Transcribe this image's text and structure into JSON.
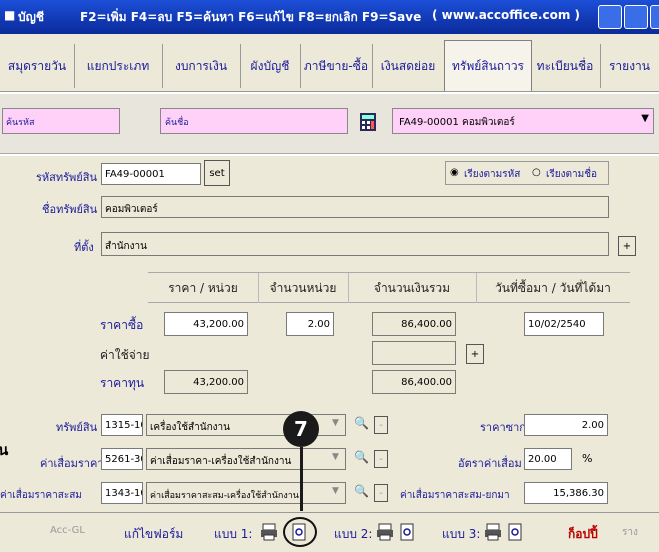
{
  "titlebar": {
    "app_label": "บัญชี",
    "shortcuts": "F2=เพิ่ม F4=ลบ F5=ค้นหา F6=แก้ไข F8=ยกเลิก F9=Save",
    "website": "( www.accoffice.com )"
  },
  "tabs": [
    {
      "label": "สมุดรายวัน"
    },
    {
      "label": "แยกประเภท"
    },
    {
      "label": "งบการเงิน"
    },
    {
      "label": "ผังบัญชี"
    },
    {
      "label": "ภาษีขาย-ซื้อ"
    },
    {
      "label": "เงินสดย่อย"
    },
    {
      "label": "ทรัพย์สินถาวร"
    },
    {
      "label": "ทะเบียนชื่อ"
    },
    {
      "label": "รายงาน"
    }
  ],
  "search": {
    "code_label": "ค้นรหัส",
    "name_label": "ค้นชื่อ",
    "selected_value": "FA49-00001   คอมพิวเตอร์"
  },
  "asset": {
    "code_label": "รหัสทรัพย์สิน",
    "code_value": "FA49-00001",
    "set_button": "set",
    "sort_by_code": "เรียงตามรหัส",
    "sort_by_name": "เรียงตามชื่อ",
    "name_label": "ชื่อทรัพย์สิน",
    "name_value": "คอมพิวเตอร์",
    "location_label": "ที่ตั้ง",
    "location_value": "สำนักงาน",
    "add_location_button": "+"
  },
  "price_table": {
    "headers": [
      "ราคา / หน่วย",
      "จำนวนหน่วย",
      "จำนวนเงินรวม",
      "วันที่ซื้อมา / วันที่ได้มา"
    ],
    "purchase_label": "ราคาซื้อ",
    "expense_label": "ค่าใช้จ่าย",
    "cost_label": "ราคาทุน",
    "unit_price": "43,200.00",
    "units": "2.00",
    "total": "86,400.00",
    "date": "10/02/2540",
    "expense_add_button": "+",
    "cost_unit": "43,200.00",
    "cost_total": "86,400.00"
  },
  "accounts": {
    "asset_label": "ทรัพย์สิน",
    "asset_code": "1315-10",
    "asset_name": "เครื่องใช้สำนักงาน",
    "depr_label": "ค่าเสื่อมราคา",
    "depr_code": "5261-30",
    "depr_name": "ค่าเสื่อมราคา-เครื่องใช้สำนักงาน",
    "acc_depr_label": "ค่าเสื่อมราคาสะสม",
    "acc_depr_code": "1343-10",
    "acc_depr_name": "ค่าเสื่อมราคาสะสม-เครื่องใช้สำนักงาน",
    "salvage_label": "ราคาซาก",
    "salvage_value": "2.00",
    "rate_label": "อัตราค่าเสื่อม",
    "rate_value": "20.00",
    "rate_unit": "%",
    "acc_depr_carry_label": "ค่าเสื่อมราคาสะสม-ยกมา",
    "acc_depr_carry_value": "15,386.30",
    "dash": "-",
    "left_cut_char": "น"
  },
  "callout": {
    "number": "7"
  },
  "bottombar": {
    "acc_gl": "Acc-GL",
    "edit_form": "แก้ไขฟอร์ม",
    "form1": "แบบ 1:",
    "form2": "แบบ 2:",
    "form3": "แบบ 3:",
    "save": "ก็อปปี้",
    "disabled": "ราง"
  }
}
